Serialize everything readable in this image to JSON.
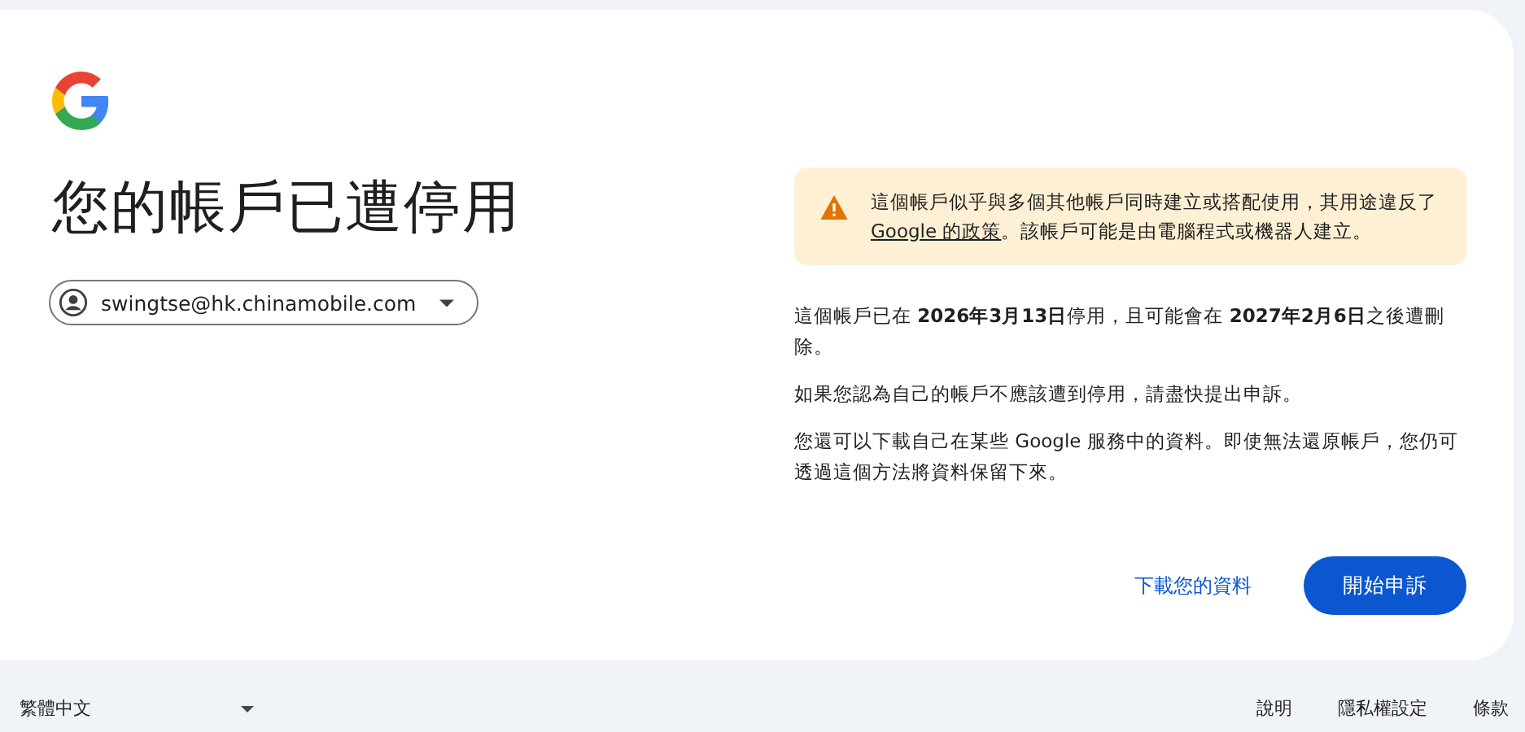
{
  "title": "您的帳戶已遭停用",
  "account": {
    "email": "swingtse@hk.chinamobile.com"
  },
  "warning": {
    "before": "這個帳戶似乎與多個其他帳戶同時建立或搭配使用，其用途違反了 ",
    "link": "Google 的政策",
    "after": "。該帳戶可能是由電腦程式或機器人建立。"
  },
  "paragraphs": [
    "這個帳戶已在 **2026年3月13日**停用，且可能會在 **2027年2月6日**之後遭刪除。",
    "如果您認為自己的帳戶不應該遭到停用，請盡快提出申訴。",
    "您還可以下載自己在某些 Google 服務中的資料。即使無法還原帳戶，您仍可透過這個方法將資料保留下來。"
  ],
  "buttons": [
    {
      "label": "下載您的資料",
      "kind": "text"
    },
    {
      "label": "開始申訴",
      "kind": "filled"
    }
  ],
  "footer": {
    "language": "繁體中文",
    "links": [
      "說明",
      "隱私權設定",
      "條款"
    ]
  }
}
